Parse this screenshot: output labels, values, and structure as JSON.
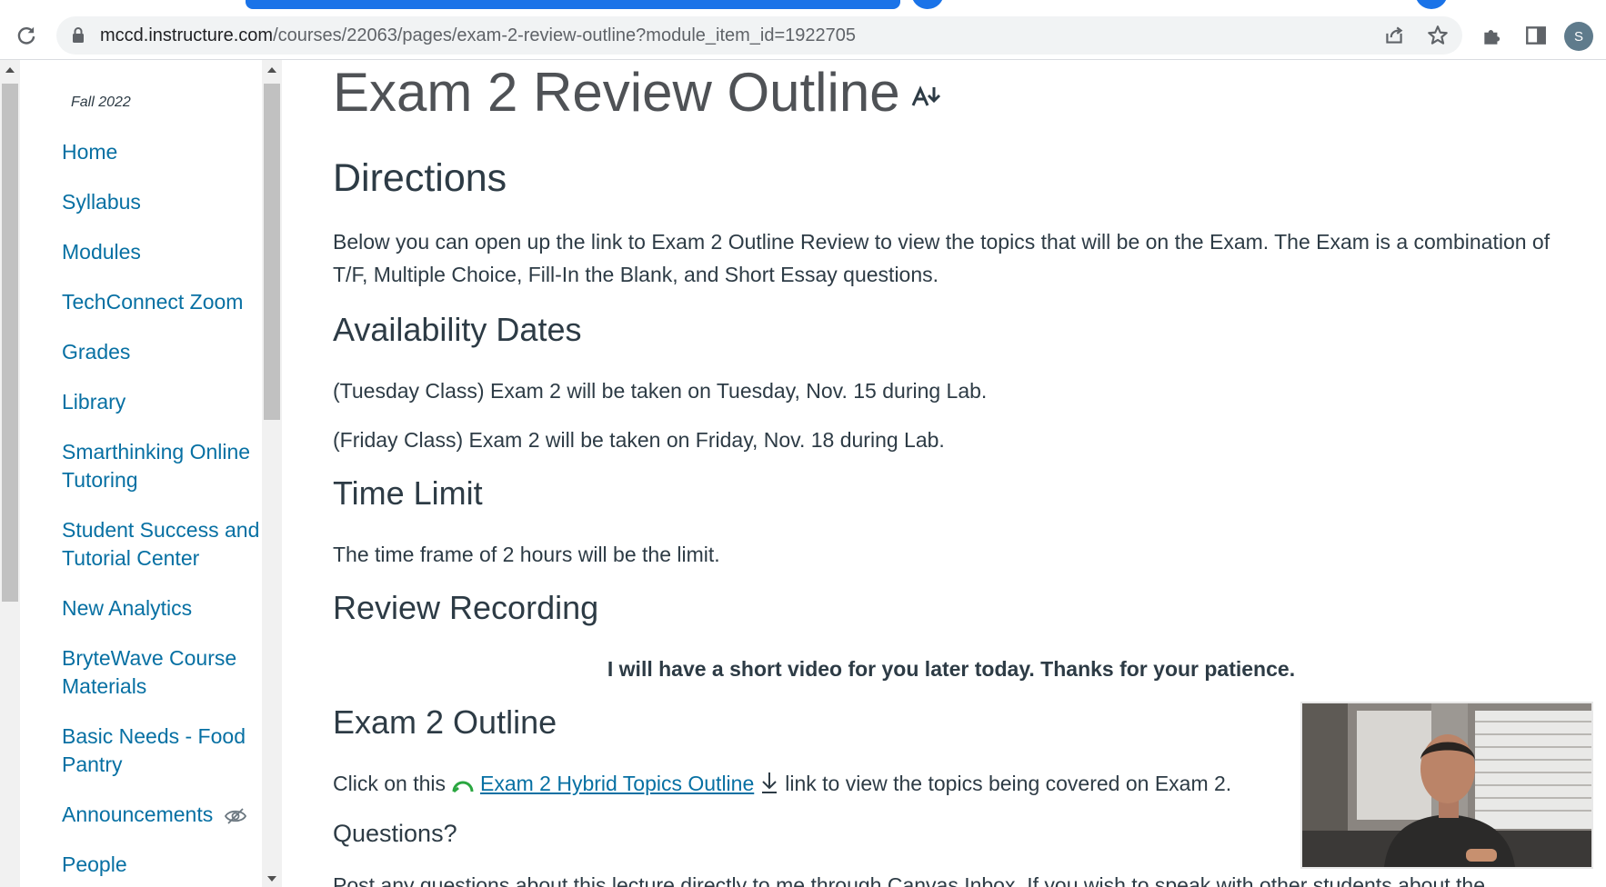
{
  "browser": {
    "url_host": "mccd.instructure.com",
    "url_path": "/courses/22063/pages/exam-2-review-outline?module_item_id=1922705",
    "avatar_letter": "S",
    "icons": [
      "reload-icon",
      "lock-icon",
      "share-icon",
      "star-icon",
      "extensions-icon",
      "side-panel-icon"
    ]
  },
  "course_nav": {
    "term": "Fall 2022",
    "items": [
      {
        "label": "Home"
      },
      {
        "label": "Syllabus"
      },
      {
        "label": "Modules"
      },
      {
        "label": "TechConnect Zoom"
      },
      {
        "label": "Grades"
      },
      {
        "label": "Library"
      },
      {
        "label": "Smarthinking Online Tutoring"
      },
      {
        "label": "Student Success and Tutorial Center"
      },
      {
        "label": "New Analytics"
      },
      {
        "label": "BryteWave Course Materials"
      },
      {
        "label": "Basic Needs - Food Pantry"
      },
      {
        "label": "Announcements",
        "icon": "eye-slash-icon"
      },
      {
        "label": "People"
      }
    ]
  },
  "page": {
    "title": "Exam 2 Review Outline",
    "directions_heading": "Directions",
    "directions_text": "Below you can open up the link to Exam 2 Outline Review to view the topics that will be on the Exam. The Exam is a combination of T/F, Multiple Choice, Fill-In the Blank, and Short Essay questions.",
    "availability_heading": "Availability Dates",
    "availability_tuesday": "(Tuesday Class) Exam 2 will be taken on Tuesday, Nov. 15 during Lab.",
    "availability_friday": "(Friday Class) Exam 2 will be taken on Friday, Nov. 18 during Lab.",
    "time_heading": "Time Limit",
    "time_text": "The time frame of 2 hours will be the limit.",
    "recording_heading": "Review Recording",
    "recording_text": "I will have a short video for you later today. Thanks for your patience.",
    "outline_heading": "Exam 2 Outline",
    "outline_prefix": "Click on this",
    "outline_link": "Exam 2 Hybrid Topics Outline",
    "outline_suffix": "link to view the topics being covered on Exam 2.",
    "questions_heading": "Questions?",
    "questions_text": "Post any questions about this lecture directly to me through Canvas Inbox. If you wish to speak with other students about the"
  },
  "colors": {
    "link": "#0770a3",
    "text": "#2d3b45",
    "title": "#4f5256",
    "chrome_accent": "#1a73e8"
  }
}
